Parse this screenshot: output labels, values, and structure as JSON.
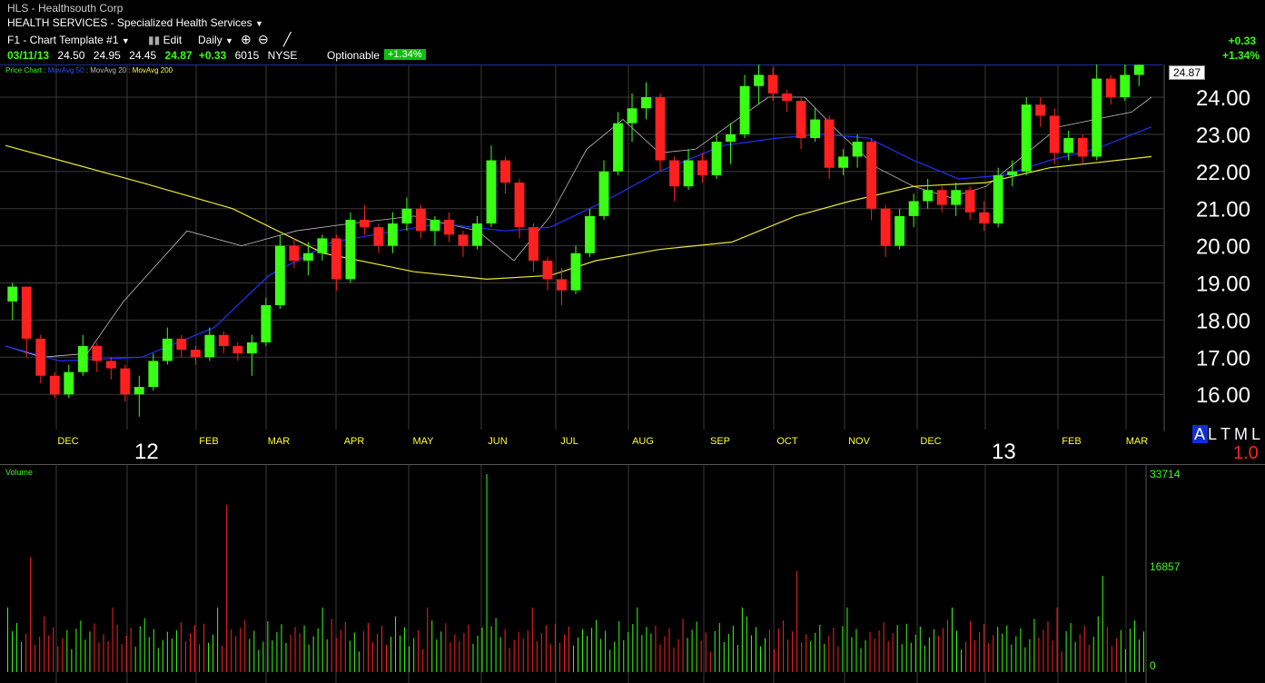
{
  "header": {
    "symbol_line": "HLS - Healthsouth Corp",
    "sector_line": "HEALTH SERVICES - Specialized Health Services",
    "template_label": "F1 - Chart Template #1",
    "edit_label": "Edit",
    "period_label": "Daily",
    "quote": {
      "date": "03/11/13",
      "open": "24.50",
      "high": "24.95",
      "low": "24.45",
      "last": "24.87",
      "change": "+0.33",
      "volume": "6015",
      "exchange": "NYSE",
      "optionable": "Optionable",
      "pct_badge": "+1.34%"
    },
    "right_change": "+0.33",
    "right_pct": "+1.34%"
  },
  "legend": {
    "price_chart": "Price Chart",
    "ma50": "MovAvg 50",
    "ma20": "MovAvg 20",
    "ma200": "MovAvg 200"
  },
  "price_tag": "24.87",
  "axis_right_labels": [
    "24.00",
    "23.00",
    "22.00",
    "21.00",
    "20.00",
    "19.00",
    "18.00",
    "17.00",
    "16.00"
  ],
  "month_labels": [
    "DEC",
    "FEB",
    "MAR",
    "APR",
    "MAY",
    "JUN",
    "JUL",
    "AUG",
    "SEP",
    "OCT",
    "NOV",
    "DEC",
    "FEB",
    "MAR"
  ],
  "year_labels": [
    "12",
    "13"
  ],
  "scale_controls": {
    "a": "A",
    "l": "L",
    "t": "T",
    "m": "M",
    "l2": "L",
    "ratio": "1.0"
  },
  "volume_panel": {
    "title": "Volume",
    "axis_labels": [
      "33714",
      "16857",
      "0"
    ]
  },
  "colors": {
    "up": "#39ff14",
    "down": "#ff2020",
    "ma20": "#c0c0c0",
    "ma50": "#2030ff",
    "ma200": "#e8e830",
    "grid": "#3a3a3a"
  },
  "chart_data": {
    "type": "candlestick",
    "y_axis": {
      "min": 16,
      "max": 24,
      "unit": "USD"
    },
    "series": [
      {
        "name": "MovAvg 20",
        "anchors": [
          [
            0,
            17.3
          ],
          [
            40,
            17.0
          ],
          [
            90,
            17.1
          ],
          [
            130,
            18.5
          ],
          [
            200,
            20.4
          ],
          [
            260,
            20.0
          ],
          [
            320,
            20.4
          ],
          [
            380,
            20.6
          ],
          [
            450,
            20.8
          ],
          [
            520,
            20.4
          ],
          [
            560,
            19.6
          ],
          [
            600,
            20.8
          ],
          [
            640,
            22.6
          ],
          [
            680,
            23.4
          ],
          [
            720,
            22.5
          ],
          [
            760,
            22.6
          ],
          [
            800,
            23.3
          ],
          [
            840,
            24.0
          ],
          [
            880,
            24.0
          ],
          [
            920,
            23.0
          ],
          [
            960,
            22.1
          ],
          [
            1000,
            21.6
          ],
          [
            1040,
            21.3
          ],
          [
            1080,
            21.6
          ],
          [
            1120,
            22.4
          ],
          [
            1160,
            23.2
          ],
          [
            1200,
            23.4
          ],
          [
            1240,
            23.6
          ],
          [
            1262,
            24.0
          ]
        ]
      },
      {
        "name": "MovAvg 50",
        "anchors": [
          [
            0,
            17.3
          ],
          [
            60,
            16.9
          ],
          [
            150,
            17.0
          ],
          [
            230,
            17.8
          ],
          [
            290,
            19.2
          ],
          [
            360,
            20.1
          ],
          [
            430,
            20.4
          ],
          [
            480,
            20.6
          ],
          [
            550,
            20.4
          ],
          [
            600,
            20.5
          ],
          [
            660,
            21.2
          ],
          [
            720,
            22.0
          ],
          [
            790,
            22.7
          ],
          [
            850,
            22.9
          ],
          [
            900,
            23.0
          ],
          [
            950,
            22.9
          ],
          [
            1000,
            22.3
          ],
          [
            1050,
            21.8
          ],
          [
            1100,
            21.9
          ],
          [
            1150,
            22.3
          ],
          [
            1200,
            22.6
          ],
          [
            1262,
            23.2
          ]
        ]
      },
      {
        "name": "MovAvg 200",
        "anchors": [
          [
            0,
            22.7
          ],
          [
            60,
            22.3
          ],
          [
            150,
            21.7
          ],
          [
            250,
            21.0
          ],
          [
            350,
            19.8
          ],
          [
            450,
            19.3
          ],
          [
            530,
            19.1
          ],
          [
            600,
            19.2
          ],
          [
            650,
            19.6
          ],
          [
            720,
            19.9
          ],
          [
            800,
            20.1
          ],
          [
            870,
            20.8
          ],
          [
            930,
            21.2
          ],
          [
            1000,
            21.6
          ],
          [
            1080,
            21.7
          ],
          [
            1150,
            22.1
          ],
          [
            1262,
            22.4
          ]
        ]
      }
    ],
    "candles": [
      [
        18.5,
        19.0,
        18.0,
        18.9
      ],
      [
        18.9,
        18.9,
        17.0,
        17.5
      ],
      [
        17.5,
        17.6,
        16.3,
        16.5
      ],
      [
        16.5,
        16.6,
        15.9,
        16.0
      ],
      [
        16.0,
        16.8,
        15.9,
        16.6
      ],
      [
        16.6,
        17.6,
        16.5,
        17.3
      ],
      [
        17.3,
        17.4,
        16.6,
        16.9
      ],
      [
        16.9,
        17.0,
        16.4,
        16.7
      ],
      [
        16.7,
        16.8,
        15.8,
        16.0
      ],
      [
        16.0,
        16.5,
        15.4,
        16.2
      ],
      [
        16.2,
        17.1,
        16.1,
        16.9
      ],
      [
        16.9,
        17.8,
        16.8,
        17.5
      ],
      [
        17.5,
        17.6,
        17.0,
        17.2
      ],
      [
        17.2,
        17.3,
        16.8,
        17.0
      ],
      [
        17.0,
        17.8,
        16.9,
        17.6
      ],
      [
        17.6,
        17.7,
        17.1,
        17.3
      ],
      [
        17.3,
        17.4,
        16.9,
        17.1
      ],
      [
        17.1,
        17.6,
        16.5,
        17.4
      ],
      [
        17.4,
        18.6,
        17.3,
        18.4
      ],
      [
        18.4,
        20.3,
        18.3,
        20.0
      ],
      [
        20.0,
        20.2,
        19.4,
        19.6
      ],
      [
        19.6,
        20.1,
        19.2,
        19.8
      ],
      [
        19.8,
        20.3,
        19.6,
        20.2
      ],
      [
        20.2,
        20.3,
        18.8,
        19.1
      ],
      [
        19.1,
        20.9,
        19.0,
        20.7
      ],
      [
        20.7,
        21.1,
        20.3,
        20.5
      ],
      [
        20.5,
        20.6,
        19.8,
        20.0
      ],
      [
        20.0,
        20.9,
        19.8,
        20.6
      ],
      [
        20.6,
        21.3,
        20.4,
        21.0
      ],
      [
        21.0,
        21.1,
        20.2,
        20.4
      ],
      [
        20.4,
        20.8,
        20.0,
        20.7
      ],
      [
        20.7,
        20.9,
        20.1,
        20.3
      ],
      [
        20.3,
        20.4,
        19.7,
        20.0
      ],
      [
        20.0,
        20.8,
        19.9,
        20.6
      ],
      [
        20.6,
        22.7,
        20.5,
        22.3
      ],
      [
        22.3,
        22.4,
        21.4,
        21.7
      ],
      [
        21.7,
        21.8,
        20.2,
        20.5
      ],
      [
        20.5,
        20.6,
        19.3,
        19.6
      ],
      [
        19.6,
        19.7,
        18.8,
        19.1
      ],
      [
        19.1,
        19.4,
        18.4,
        18.8
      ],
      [
        18.8,
        20.0,
        18.7,
        19.8
      ],
      [
        19.8,
        21.0,
        19.7,
        20.8
      ],
      [
        20.8,
        22.3,
        20.7,
        22.0
      ],
      [
        22.0,
        23.6,
        21.9,
        23.3
      ],
      [
        23.3,
        24.1,
        22.8,
        23.7
      ],
      [
        23.7,
        24.4,
        23.4,
        24.0
      ],
      [
        24.0,
        24.1,
        22.0,
        22.3
      ],
      [
        22.3,
        22.4,
        21.2,
        21.6
      ],
      [
        21.6,
        22.6,
        21.5,
        22.3
      ],
      [
        22.3,
        22.5,
        21.7,
        21.9
      ],
      [
        21.9,
        23.0,
        21.8,
        22.8
      ],
      [
        22.8,
        23.3,
        22.2,
        23.0
      ],
      [
        23.0,
        24.6,
        22.9,
        24.3
      ],
      [
        24.3,
        24.9,
        23.8,
        24.6
      ],
      [
        24.6,
        24.8,
        23.9,
        24.1
      ],
      [
        24.1,
        24.2,
        23.6,
        23.9
      ],
      [
        23.9,
        24.0,
        22.6,
        22.9
      ],
      [
        22.9,
        23.7,
        22.8,
        23.4
      ],
      [
        23.4,
        23.5,
        21.8,
        22.1
      ],
      [
        22.1,
        22.6,
        21.9,
        22.4
      ],
      [
        22.4,
        23.0,
        22.1,
        22.8
      ],
      [
        22.8,
        22.9,
        20.7,
        21.0
      ],
      [
        21.0,
        21.1,
        19.7,
        20.0
      ],
      [
        20.0,
        21.0,
        19.9,
        20.8
      ],
      [
        20.8,
        21.4,
        20.5,
        21.2
      ],
      [
        21.2,
        21.8,
        21.0,
        21.5
      ],
      [
        21.5,
        21.6,
        20.9,
        21.1
      ],
      [
        21.1,
        21.7,
        20.8,
        21.5
      ],
      [
        21.5,
        21.6,
        20.7,
        20.9
      ],
      [
        20.9,
        21.2,
        20.4,
        20.6
      ],
      [
        20.6,
        22.1,
        20.5,
        21.9
      ],
      [
        21.9,
        22.3,
        21.6,
        22.0
      ],
      [
        22.0,
        24.0,
        21.9,
        23.8
      ],
      [
        23.8,
        24.0,
        23.2,
        23.5
      ],
      [
        23.5,
        23.7,
        22.2,
        22.5
      ],
      [
        22.5,
        23.1,
        22.3,
        22.9
      ],
      [
        22.9,
        23.0,
        22.2,
        22.4
      ],
      [
        22.4,
        25.0,
        22.3,
        24.5
      ],
      [
        24.5,
        24.6,
        23.8,
        24.0
      ],
      [
        24.0,
        24.9,
        23.9,
        24.6
      ],
      [
        24.6,
        25.0,
        24.3,
        24.87
      ]
    ],
    "volume_axis": {
      "min": 0,
      "max": 33714,
      "mid": 16857
    },
    "x_months": [
      "DEC",
      "FEB",
      "MAR",
      "APR",
      "MAY",
      "JUN",
      "JUL",
      "AUG",
      "SEP",
      "OCT",
      "NOV",
      "DEC",
      "FEB",
      "MAR"
    ]
  }
}
